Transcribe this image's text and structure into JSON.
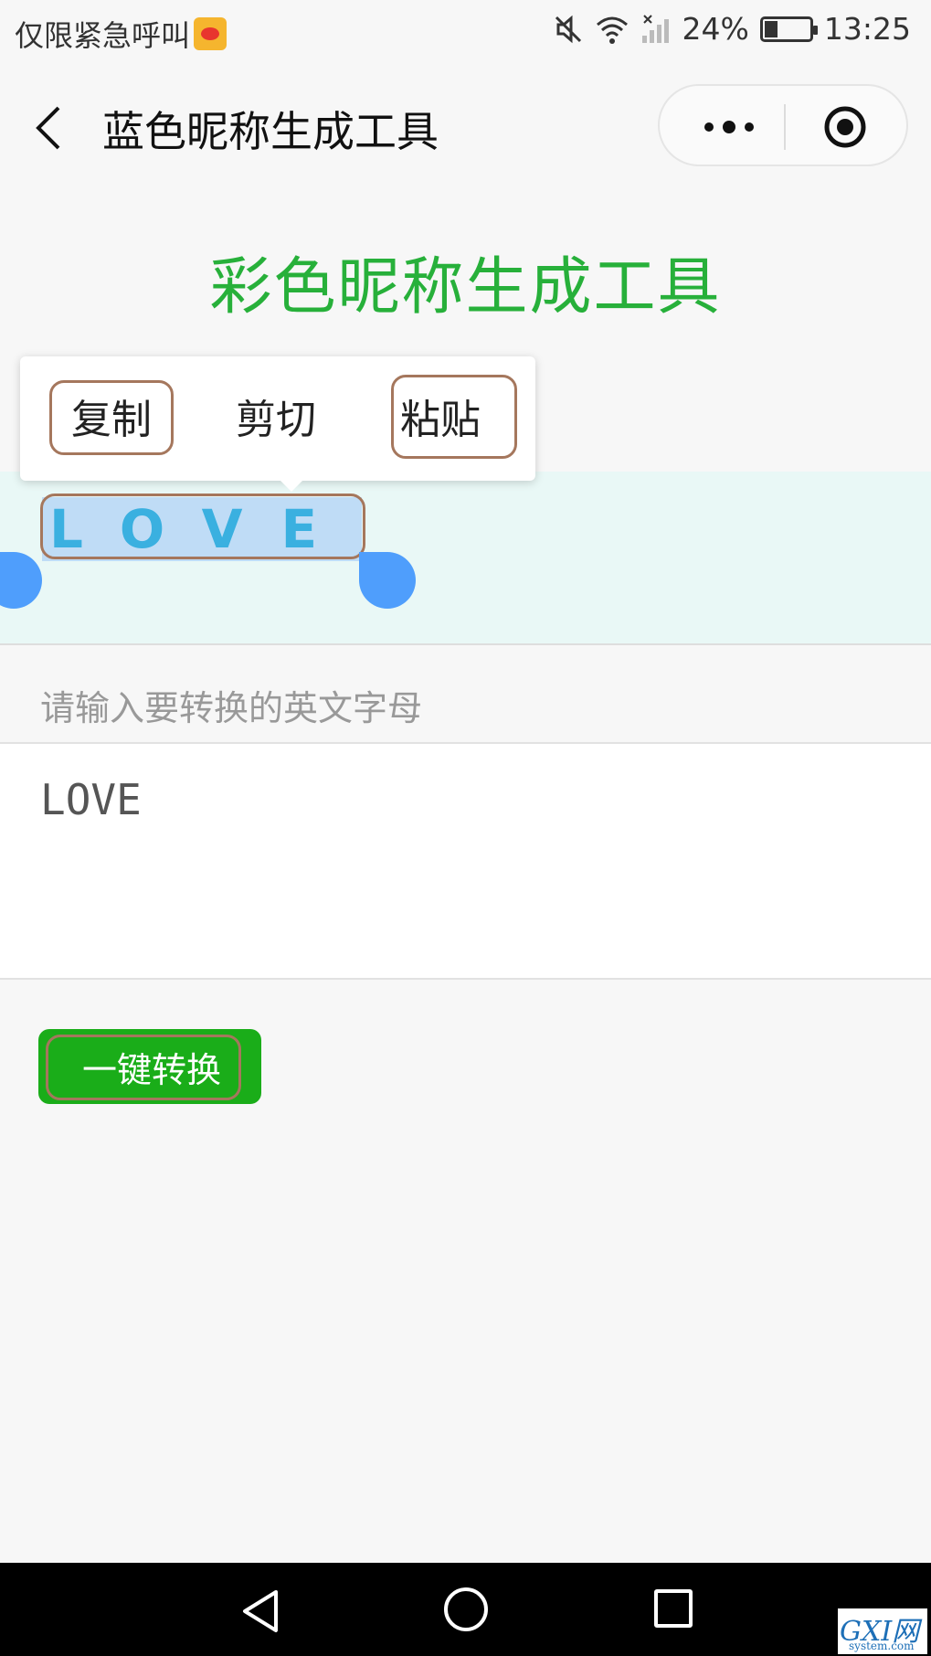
{
  "status_bar": {
    "left_text": "仅限紧急呼叫",
    "battery": "24%",
    "time": "13:25",
    "icons": [
      "weibo-icon",
      "mute-icon",
      "wifi-icon",
      "signal-icon",
      "battery-icon"
    ]
  },
  "nav_bar": {
    "title": "蓝色昵称生成工具",
    "icons": [
      "back-icon",
      "more-icon",
      "close-miniprogram-icon"
    ]
  },
  "main": {
    "heading": "彩色昵称生成工具",
    "context_menu": {
      "copy": "复制",
      "cut": "剪切",
      "paste": "粘贴"
    },
    "result_text": "LOVE",
    "input_label": "请输入要转换的英文字母",
    "input_value": "LOVE",
    "convert_button": "一键转换"
  },
  "watermark": {
    "main": "GXI网",
    "sub": "system.com"
  },
  "colors": {
    "heading": "#27b03a",
    "button": "#1aad19",
    "result_text": "#3ab0e0",
    "selection_handle": "#4f9efc",
    "highlight_box": "#a5775d"
  }
}
